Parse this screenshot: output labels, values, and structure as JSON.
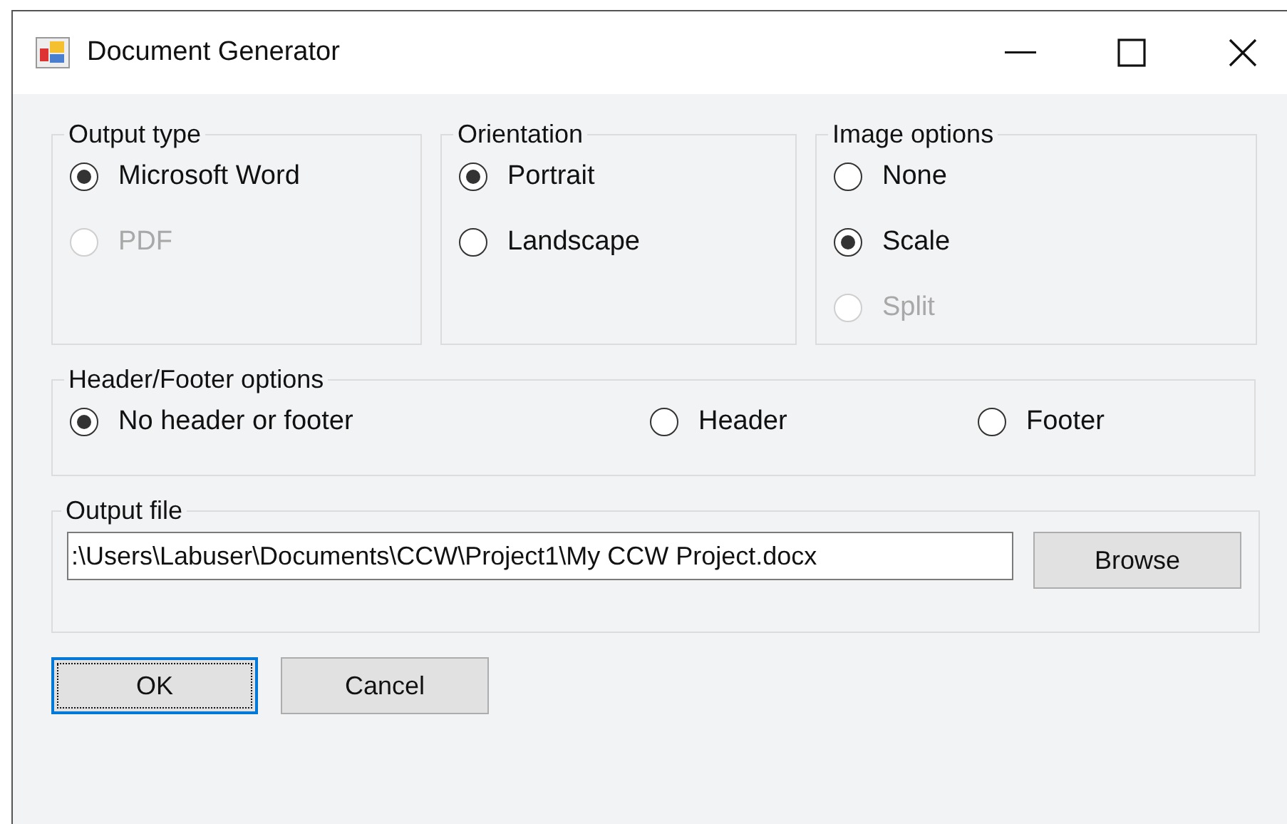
{
  "window": {
    "title": "Document Generator"
  },
  "groups": [
    {
      "title": "Output type",
      "options": [
        {
          "label": "Microsoft Word",
          "selected": true,
          "disabled": false
        },
        {
          "label": "PDF",
          "selected": false,
          "disabled": true
        }
      ]
    },
    {
      "title": "Orientation",
      "options": [
        {
          "label": "Portrait",
          "selected": true,
          "disabled": false
        },
        {
          "label": "Landscape",
          "selected": false,
          "disabled": false
        }
      ]
    },
    {
      "title": "Image options",
      "options": [
        {
          "label": "None",
          "selected": false,
          "disabled": false
        },
        {
          "label": "Scale",
          "selected": true,
          "disabled": false
        },
        {
          "label": "Split",
          "selected": false,
          "disabled": true
        }
      ]
    }
  ],
  "header_footer": {
    "title": "Header/Footer options",
    "options": [
      {
        "label": "No header or footer",
        "selected": true,
        "disabled": false
      },
      {
        "label": "Header",
        "selected": false,
        "disabled": false
      },
      {
        "label": "Footer",
        "selected": false,
        "disabled": false
      }
    ]
  },
  "output_file": {
    "title": "Output file",
    "value": ":\\Users\\Labuser\\Documents\\CCW\\Project1\\My CCW Project.docx",
    "button": "Browse"
  },
  "buttons": [
    {
      "label": "OK",
      "focused": true
    },
    {
      "label": "Cancel",
      "focused": false
    }
  ]
}
